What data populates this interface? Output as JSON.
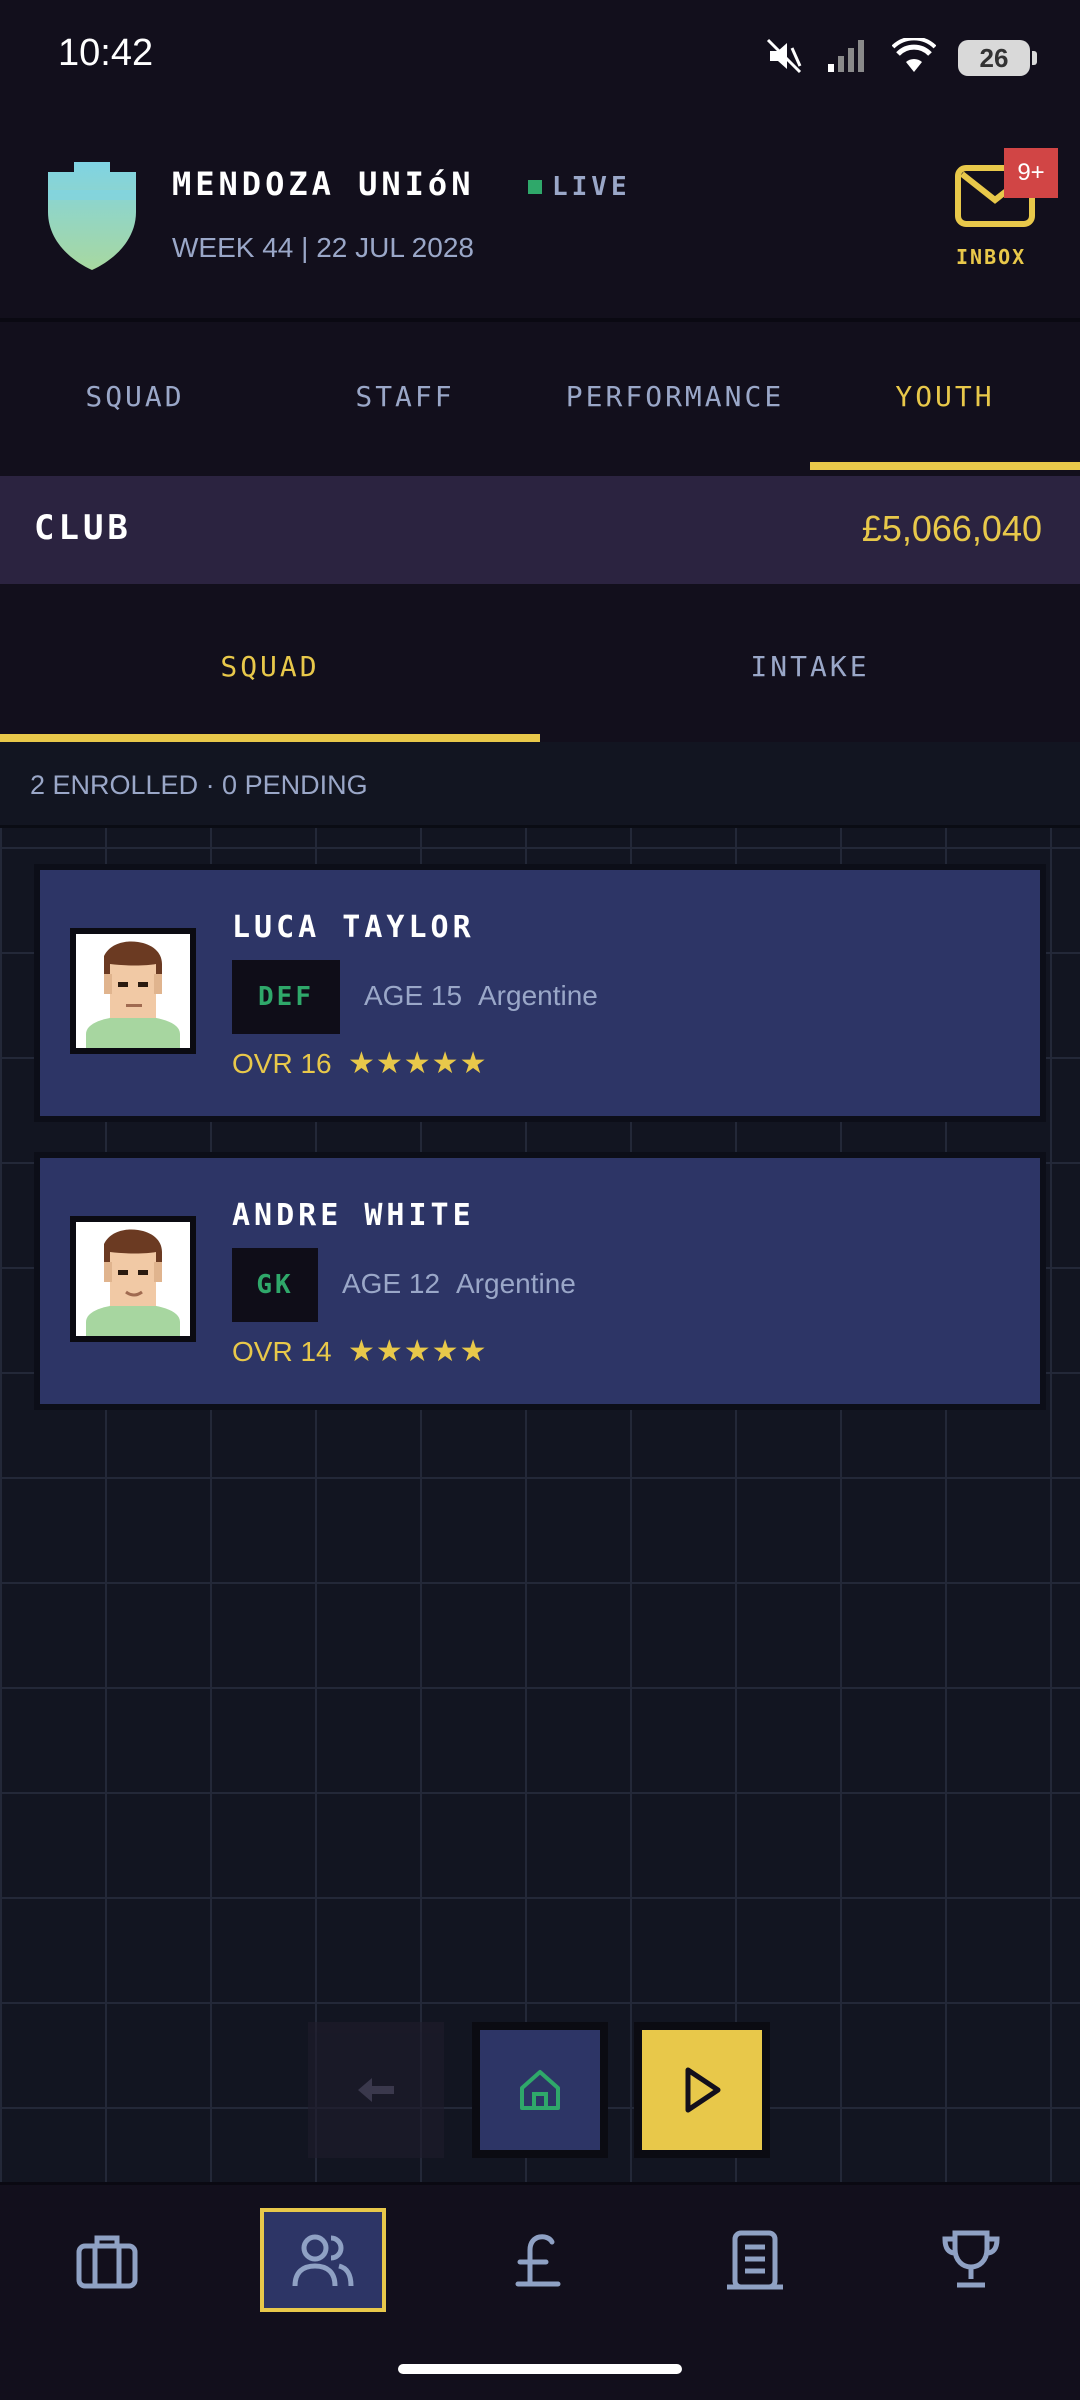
{
  "status_bar": {
    "time": "10:42",
    "battery": "26",
    "icons": [
      "mute-icon",
      "signal-icon",
      "wifi-icon",
      "battery-icon"
    ]
  },
  "header": {
    "club_name": "MENDOZA UNIóN",
    "live_label": "LIVE",
    "week_line": "WEEK 44  |  22 JUL 2028",
    "inbox_label": "INBOX",
    "inbox_badge": "9+"
  },
  "main_tabs": [
    {
      "label": "SQUAD",
      "active": false
    },
    {
      "label": "STAFF",
      "active": false
    },
    {
      "label": "PERFORMANCE",
      "active": false
    },
    {
      "label": "YOUTH",
      "active": true
    }
  ],
  "club_bar": {
    "label": "CLUB",
    "balance": "£5,066,040"
  },
  "sub_tabs": [
    {
      "label": "SQUAD",
      "active": true
    },
    {
      "label": "INTAKE",
      "active": false
    }
  ],
  "summary": "2 ENROLLED · 0 PENDING",
  "players": [
    {
      "name": "LUCA TAYLOR",
      "position": "DEF",
      "age": "AGE 15",
      "nationality": "Argentine",
      "ovr": "OVR 16",
      "stars": "★★★★★"
    },
    {
      "name": "ANDRE WHITE",
      "position": "GK",
      "age": "AGE 12",
      "nationality": "Argentine",
      "ovr": "OVR 14",
      "stars": "★★★★★"
    }
  ],
  "actions": [
    "back-icon",
    "home-icon",
    "play-icon"
  ],
  "bottom_nav": [
    "briefcase-icon",
    "people-icon",
    "pound-icon",
    "building-icon",
    "trophy-icon"
  ],
  "colors": {
    "background": "#120f1c",
    "accent": "#e8c84a",
    "card": "#2d3566",
    "live": "#2fa86a",
    "badge": "#d14545"
  }
}
